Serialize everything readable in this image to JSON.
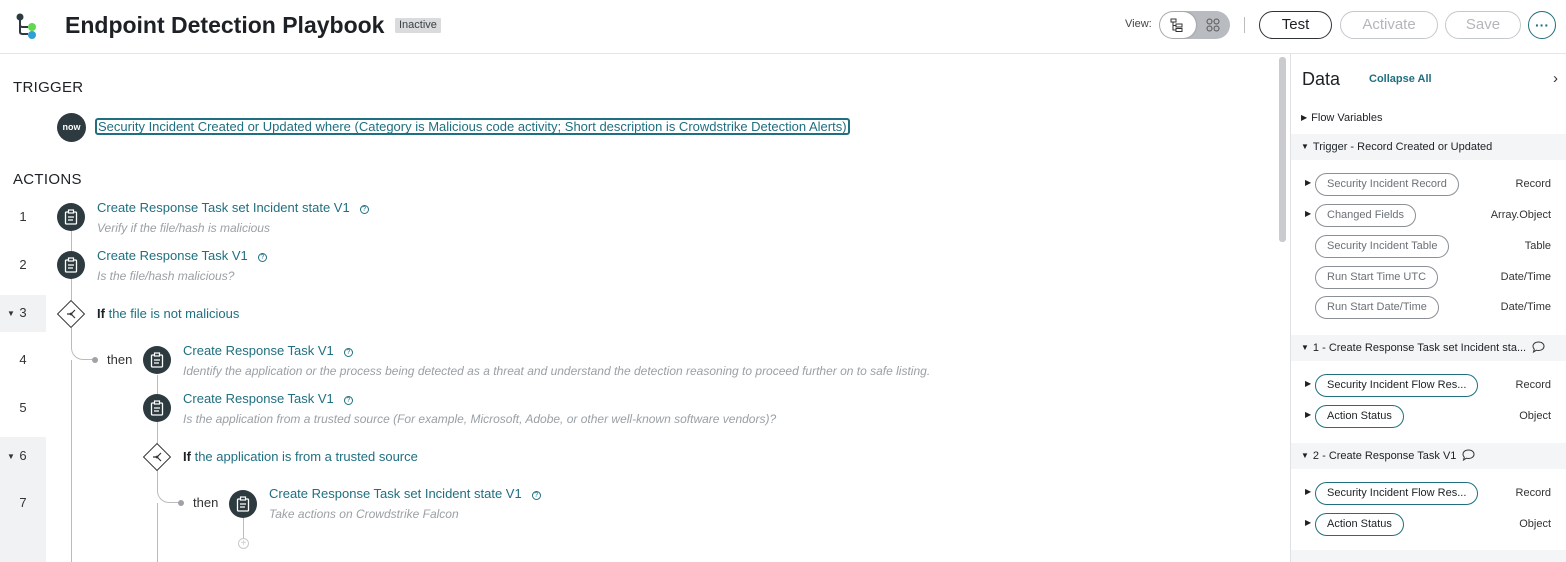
{
  "header": {
    "title": "Endpoint Detection Playbook",
    "status": "Inactive",
    "view_label": "View:",
    "buttons": {
      "test": "Test",
      "activate": "Activate",
      "save": "Save",
      "more": "···"
    }
  },
  "canvas": {
    "trigger_label": "TRIGGER",
    "actions_label": "ACTIONS",
    "trigger": {
      "logo": "now",
      "text": "Security Incident Created or Updated where (Category is Malicious code activity; Short description is Crowdstrike Detection Alerts)"
    },
    "rows": [
      {
        "num": "1",
        "title": "Create Response Task set Incident state V1",
        "desc": "Verify if the file/hash is malicious"
      },
      {
        "num": "2",
        "title": "Create Response Task V1",
        "desc": "Is the file/hash malicious?"
      },
      {
        "num": "3",
        "kw": "If",
        "cond": "the file is not malicious"
      },
      {
        "num": "4",
        "then": "then",
        "title": "Create Response Task V1",
        "desc": "Identify the application or the process being detected as a threat and understand the detection reasoning to proceed further on to safe listing."
      },
      {
        "num": "5",
        "title": "Create Response Task V1",
        "desc": "Is the application from a trusted source (For example, Microsoft, Adobe, or other well-known software vendors)?"
      },
      {
        "num": "6",
        "kw": "If",
        "cond": "the application is from a trusted source"
      },
      {
        "num": "7",
        "then": "then",
        "title": "Create Response Task set Incident state V1",
        "desc": "Take actions on Crowdstrike Falcon"
      }
    ]
  },
  "data_panel": {
    "title": "Data",
    "collapse_all": "Collapse All",
    "sections": [
      {
        "label": "Flow Variables"
      },
      {
        "label": "Trigger - Record Created or Updated"
      },
      {
        "label": "1 - Create Response Task set Incident sta..."
      },
      {
        "label": "2 - Create Response Task V1"
      }
    ],
    "trigger_pills": [
      {
        "label": "Security Incident Record",
        "type": "Record"
      },
      {
        "label": "Changed Fields",
        "type": "Array.Object"
      },
      {
        "label": "Security Incident Table",
        "type": "Table"
      },
      {
        "label": "Run Start Time UTC",
        "type": "Date/Time"
      },
      {
        "label": "Run Start Date/Time",
        "type": "Date/Time"
      }
    ],
    "step1_pills": [
      {
        "label": "Security Incident Flow Res...",
        "type": "Record"
      },
      {
        "label": "Action Status",
        "type": "Object"
      }
    ],
    "step2_pills": [
      {
        "label": "Security Incident Flow Res...",
        "type": "Record"
      },
      {
        "label": "Action Status",
        "type": "Object"
      }
    ]
  }
}
